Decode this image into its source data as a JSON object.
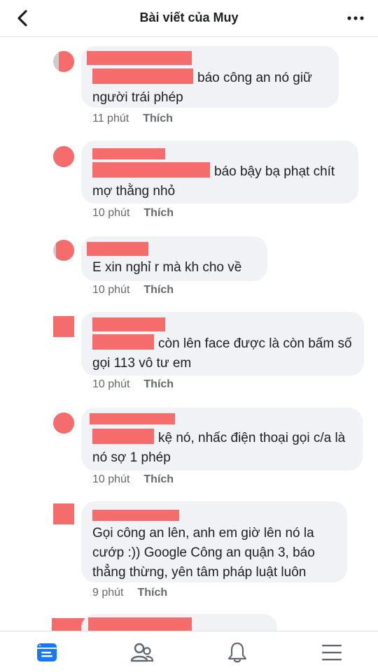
{
  "header": {
    "title": "Bài viết của Muy"
  },
  "comments": [
    {
      "text": "báo công an nó giữ người trái phép",
      "time": "11 phút",
      "like": "Thích"
    },
    {
      "text": "báo bậy bạ phạt chít mợ thằng nhỏ",
      "time": "10 phút",
      "like": "Thích"
    },
    {
      "text": "E xin nghỉ r mà kh cho về",
      "time": "10 phút",
      "like": "Thích"
    },
    {
      "text": "còn lên face được là còn bấm số gọi 113 vô tư em",
      "time": "10 phút",
      "like": "Thích"
    },
    {
      "text": "kệ nó, nhấc điện thoại gọi c/a là nó sợ 1 phép",
      "time": "10 phút",
      "like": "Thích"
    },
    {
      "text": "Gọi công an lên, anh em giờ lên nó la cướp :)) Google Công an quận 3, báo thẳng thừng, yên tâm pháp luật luôn",
      "time": "9 phút",
      "like": "Thích"
    }
  ],
  "colors": {
    "accent": "#1877f2",
    "redaction": "#f56c6c",
    "bubble": "#f0f2f5"
  },
  "tabbar": [
    "feed-icon",
    "friends-icon",
    "bell-icon",
    "menu-icon"
  ]
}
